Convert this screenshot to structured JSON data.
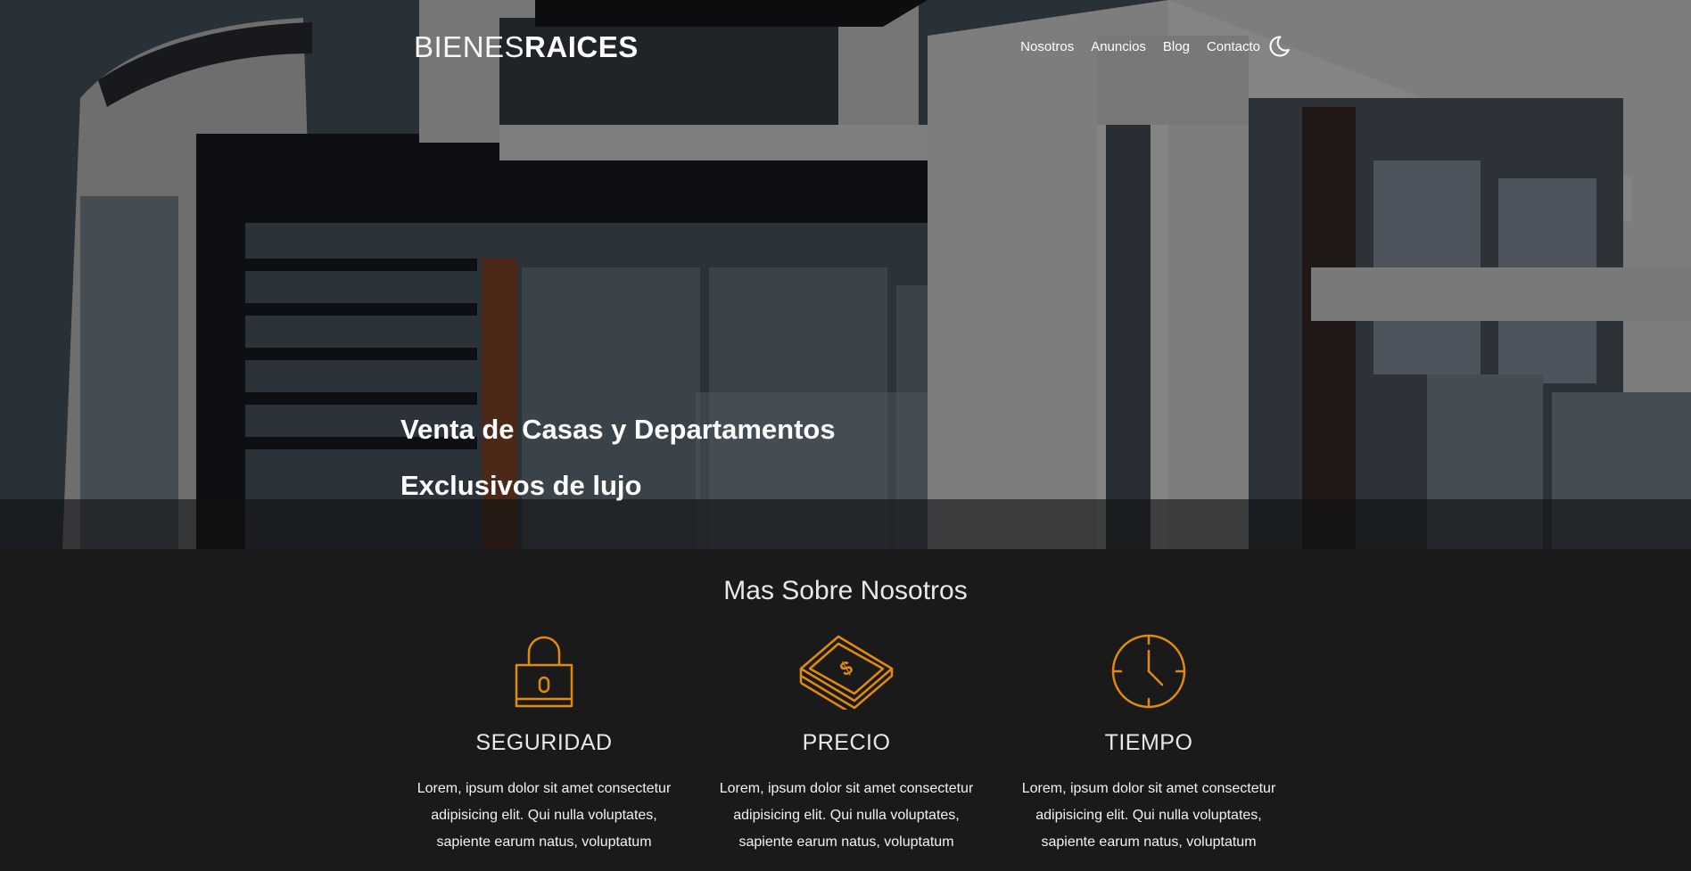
{
  "brand": {
    "logo_thin": "BIENES",
    "logo_bold": "RAICES"
  },
  "nav": {
    "items": [
      {
        "label": "Nosotros"
      },
      {
        "label": "Anuncios"
      },
      {
        "label": "Blog"
      },
      {
        "label": "Contacto"
      }
    ],
    "theme_toggle_icon": "moon-icon"
  },
  "hero": {
    "title_line1": "Venta de Casas y Departamentos",
    "title_line2": "Exclusivos de lujo"
  },
  "about": {
    "title": "Mas Sobre Nosotros",
    "features": [
      {
        "icon": "lock-icon",
        "title": "SEGURIDAD",
        "text": "Lorem, ipsum dolor sit amet consectetur adipisicing elit. Qui nulla voluptates, sapiente earum natus, voluptatum"
      },
      {
        "icon": "money-stack-icon",
        "title": "PRECIO",
        "text": "Lorem, ipsum dolor sit amet consectetur adipisicing elit. Qui nulla voluptates, sapiente earum natus, voluptatum"
      },
      {
        "icon": "clock-icon",
        "title": "TIEMPO",
        "text": "Lorem, ipsum dolor sit amet consectetur adipisicing elit. Qui nulla voluptates, sapiente earum natus, voluptatum"
      }
    ]
  },
  "colors": {
    "accent": "#e08a10",
    "background": "#1a1a1a",
    "text": "#ffffff"
  }
}
